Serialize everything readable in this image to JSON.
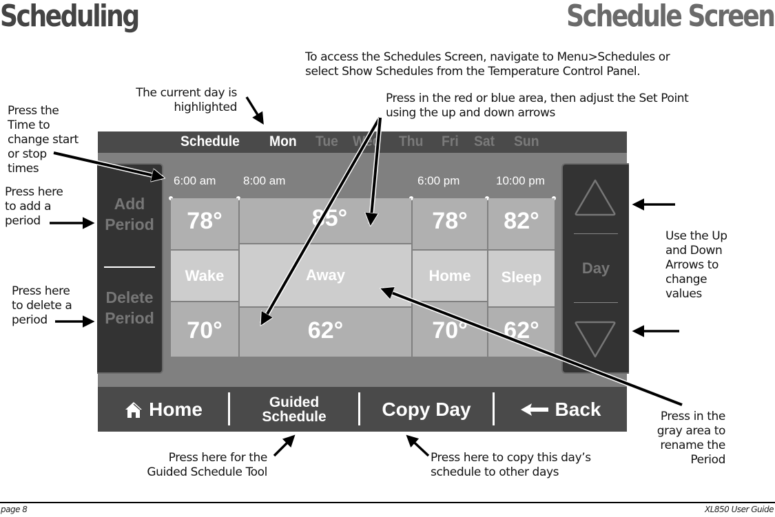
{
  "page": {
    "title_left": "Scheduling",
    "title_right": "Schedule Screen",
    "footer_left": "page 8",
    "footer_right": "XL850 User Guide"
  },
  "annotations": {
    "access": [
      "To access the Schedules Screen, navigate to Menu>Schedules or",
      "select Show Schedules from the Temperature  Control Panel."
    ],
    "current_day": [
      "The current day is",
      "highlighted"
    ],
    "set_point": [
      "Press in the red or blue area, then adjust the Set Point",
      "using the up and down arrows"
    ],
    "time": [
      "Press the",
      "Time to",
      "change start",
      "or stop",
      "times"
    ],
    "add_period": [
      "Press here",
      "to add a",
      "period"
    ],
    "delete_period": [
      "Press here",
      "to delete a",
      "period"
    ],
    "arrows": [
      "Use the Up",
      "and Down",
      "Arrows to",
      "change",
      "values"
    ],
    "rename": [
      "Press in the",
      "gray area to",
      "rename the",
      "Period"
    ],
    "guided": [
      "Press here for the",
      "Guided Schedule Tool"
    ],
    "copy": [
      "Press here to copy this day’s",
      "schedule to other days"
    ]
  },
  "device": {
    "header_label": "Schedule",
    "days": [
      {
        "label": "Mon",
        "active": true
      },
      {
        "label": "Tue",
        "active": false
      },
      {
        "label": "Wed",
        "active": false
      },
      {
        "label": "Thu",
        "active": false
      },
      {
        "label": "Fri",
        "active": false
      },
      {
        "label": "Sat",
        "active": false
      },
      {
        "label": "Sun",
        "active": false
      }
    ],
    "left_panel": {
      "add": [
        "Add",
        "Period"
      ],
      "delete": [
        "Delete",
        "Period"
      ]
    },
    "right_panel": {
      "label": "Day",
      "up_icon": "triangle-up-icon",
      "down_icon": "triangle-down-icon"
    },
    "periods": [
      {
        "time": "6:00 am",
        "name": "Wake",
        "heat": "78°",
        "cool": "70°"
      },
      {
        "time": "8:00 am",
        "name": "Away",
        "heat": "85°",
        "cool": "62°"
      },
      {
        "time": "6:00 pm",
        "name": "Home",
        "heat": "78°",
        "cool": "70°"
      },
      {
        "time": "10:00 pm",
        "name": "Sleep",
        "heat": "82°",
        "cool": "62°"
      }
    ],
    "bottom_bar": {
      "home": "Home",
      "home_icon": "house-icon",
      "guided": [
        "Guided",
        "Schedule"
      ],
      "copy_day": "Copy Day",
      "back": "Back",
      "back_icon": "arrow-left-icon"
    },
    "colors": {
      "bar": "#4a4a4a",
      "screen": "#808080",
      "panel": "#333333",
      "setpoint_cell": "#b0b0b0",
      "name_cell": "#cdcdcd",
      "inactive_day": "#7a7a7a"
    }
  }
}
